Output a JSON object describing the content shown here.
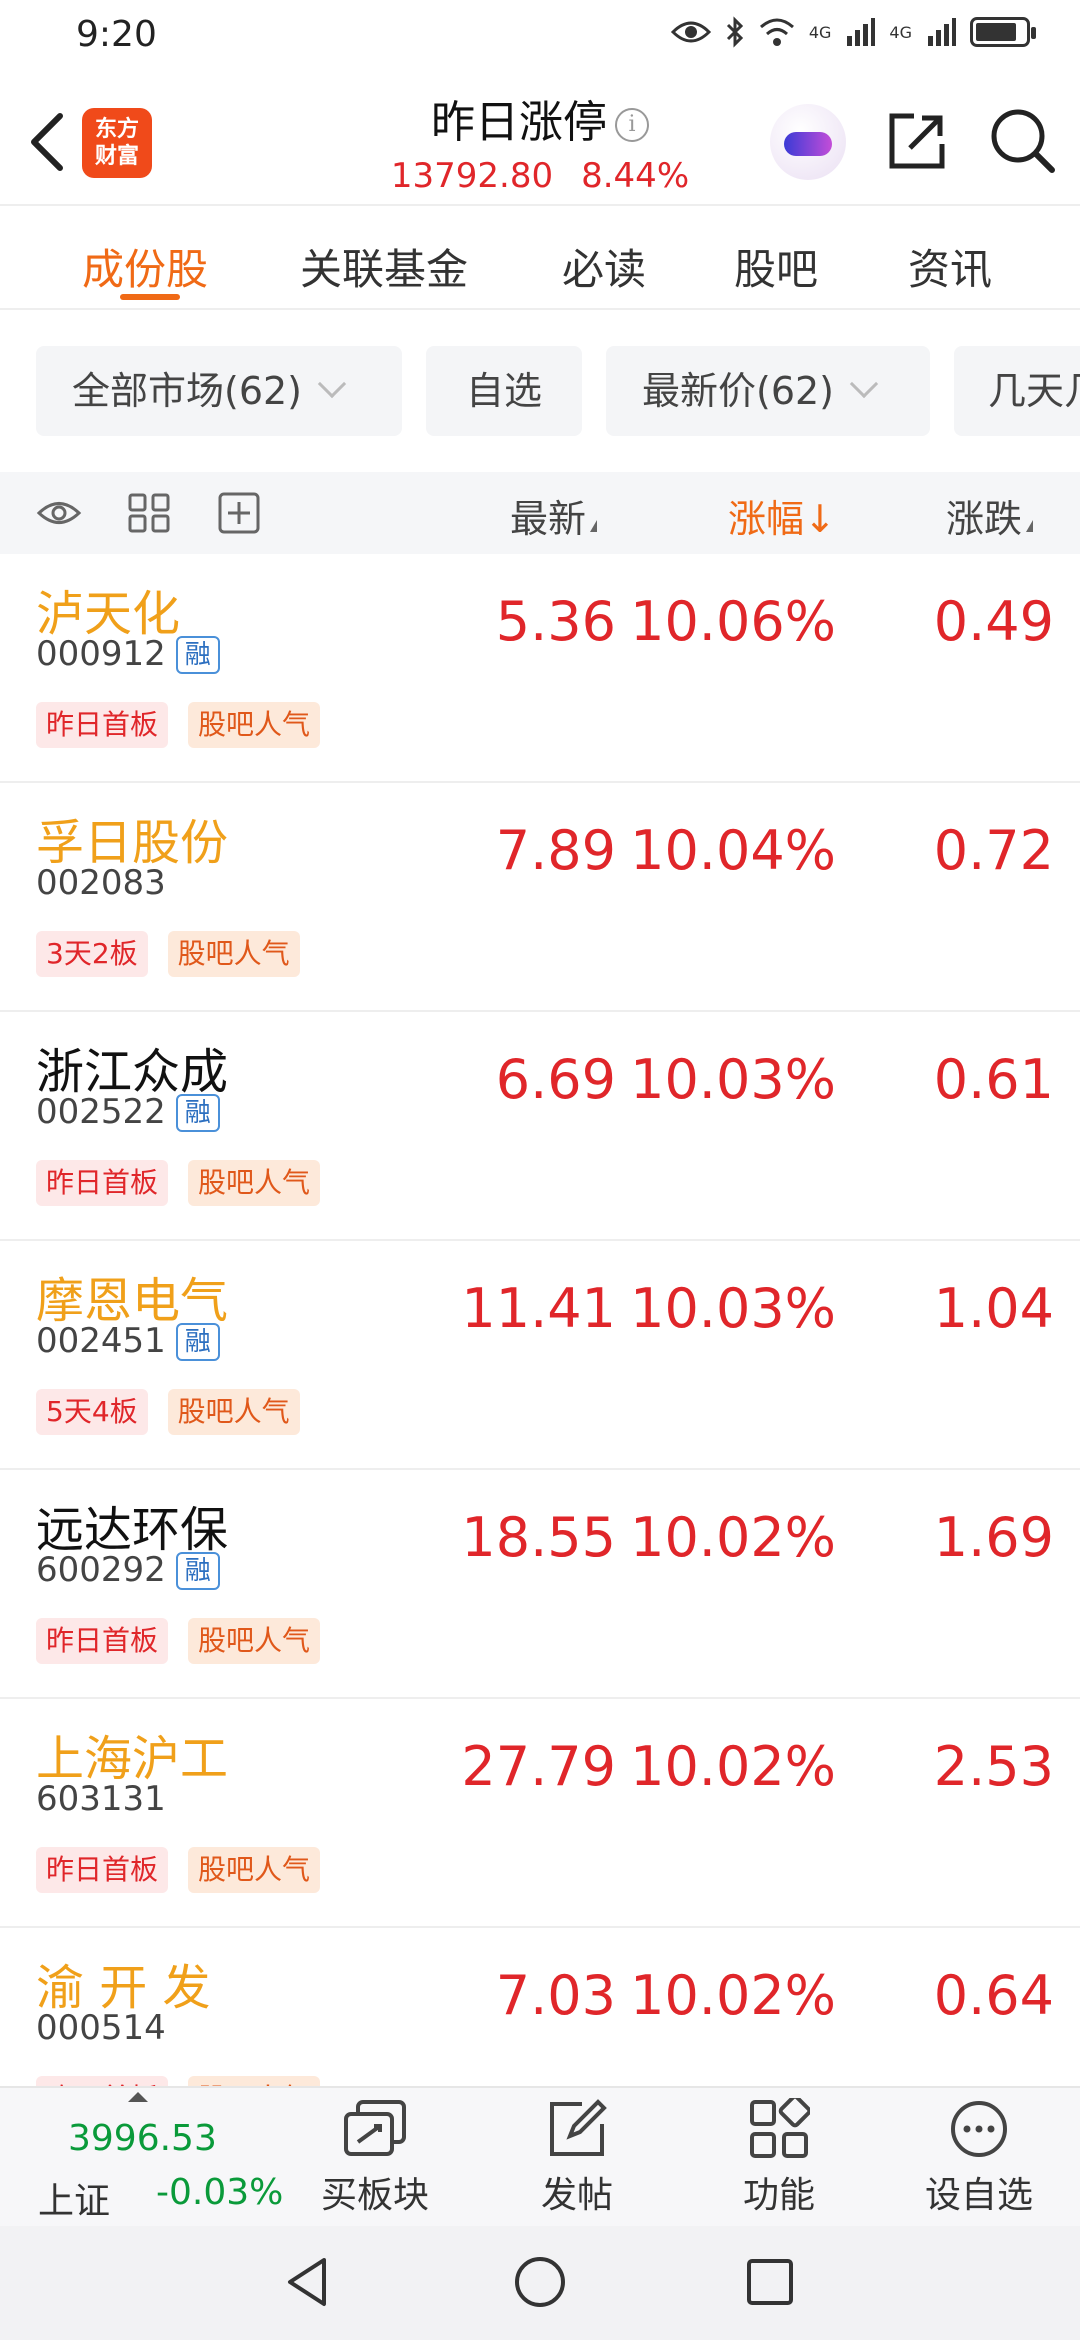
{
  "status_bar": {
    "time": "9:20",
    "net_label_1": "4G",
    "net_label_2": "4G"
  },
  "header": {
    "logo_line1": "东方",
    "logo_line2": "财富",
    "title": "昨日涨停",
    "index_value": "13792.80",
    "index_change": "8.44%"
  },
  "tabs": [
    {
      "label": "成份股",
      "active": true
    },
    {
      "label": "关联基金"
    },
    {
      "label": "必读"
    },
    {
      "label": "股吧"
    },
    {
      "label": "资讯"
    }
  ],
  "filters": {
    "market": "全部市场(62)",
    "watchlist": "自选",
    "price": "最新价(62)",
    "days": "几天几"
  },
  "columns": {
    "latest": "最新",
    "change_pct": "涨幅↓",
    "change": "涨跌"
  },
  "stocks": [
    {
      "name": "泸天化",
      "code": "000912",
      "margin": "融",
      "price": "5.36",
      "pct": "10.06%",
      "chg": "0.49",
      "tags": [
        "昨日首板",
        "股吧人气"
      ],
      "name_color": "orange"
    },
    {
      "name": "孚日股份",
      "code": "002083",
      "margin": "",
      "price": "7.89",
      "pct": "10.04%",
      "chg": "0.72",
      "tags": [
        "3天2板",
        "股吧人气"
      ],
      "name_color": "orange"
    },
    {
      "name": "浙江众成",
      "code": "002522",
      "margin": "融",
      "price": "6.69",
      "pct": "10.03%",
      "chg": "0.61",
      "tags": [
        "昨日首板",
        "股吧人气"
      ],
      "name_color": "black"
    },
    {
      "name": "摩恩电气",
      "code": "002451",
      "margin": "融",
      "price": "11.41",
      "pct": "10.03%",
      "chg": "1.04",
      "tags": [
        "5天4板",
        "股吧人气"
      ],
      "name_color": "orange"
    },
    {
      "name": "远达环保",
      "code": "600292",
      "margin": "融",
      "price": "18.55",
      "pct": "10.02%",
      "chg": "1.69",
      "tags": [
        "昨日首板",
        "股吧人气"
      ],
      "name_color": "black"
    },
    {
      "name": "上海沪工",
      "code": "603131",
      "margin": "",
      "price": "27.79",
      "pct": "10.02%",
      "chg": "2.53",
      "tags": [
        "昨日首板",
        "股吧人气"
      ],
      "name_color": "orange"
    },
    {
      "name": "渝 开 发",
      "code": "000514",
      "margin": "",
      "price": "7.03",
      "pct": "10.02%",
      "chg": "0.64",
      "tags": [
        "昨日首板",
        "股吧人气"
      ],
      "name_color": "orange"
    }
  ],
  "toolbar": {
    "index_value": "3996.53",
    "index_name": "上证",
    "index_change": "-0.03%",
    "items": [
      {
        "label": "买板块",
        "icon": "buy-sector-icon"
      },
      {
        "label": "发帖",
        "icon": "edit-post-icon"
      },
      {
        "label": "功能",
        "icon": "function-grid-icon"
      },
      {
        "label": "设自选",
        "icon": "more-options-icon"
      }
    ]
  },
  "colors": {
    "accent": "#f06a16",
    "up_red": "#e0262a",
    "down_green": "#0a9a3a",
    "name_orange": "#f0a01a"
  }
}
